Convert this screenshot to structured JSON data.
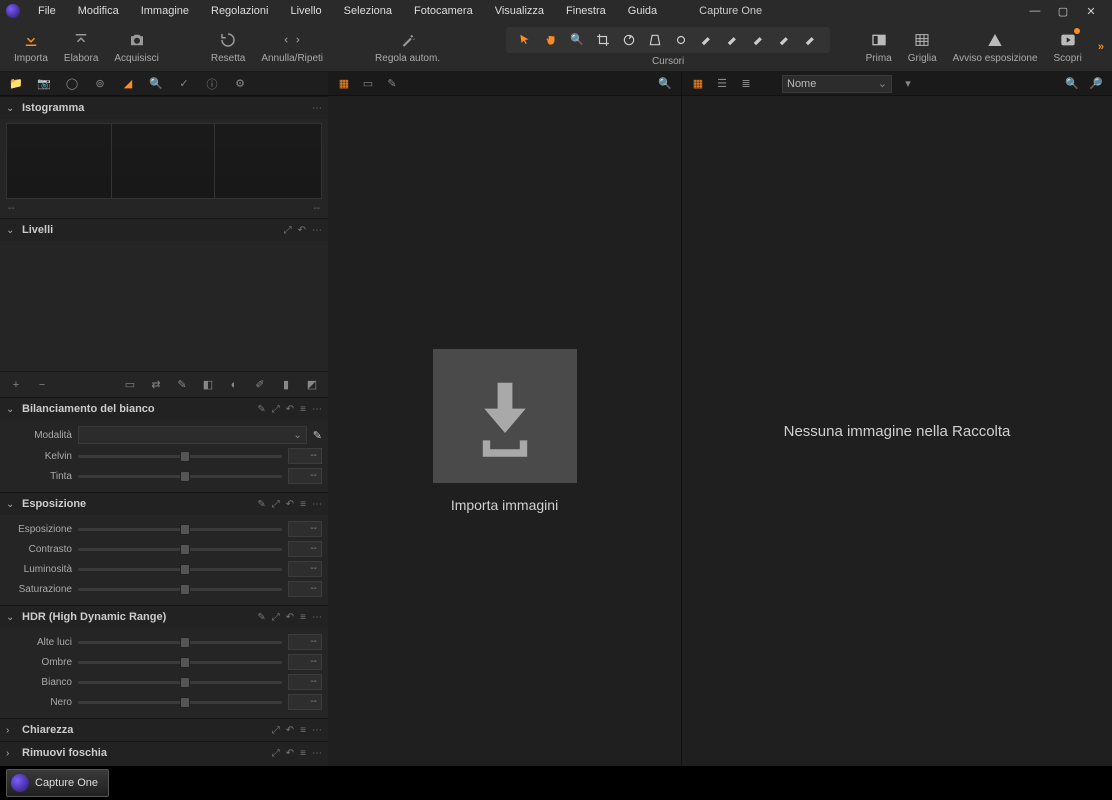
{
  "app": {
    "title": "Capture One"
  },
  "menu": [
    "File",
    "Modifica",
    "Immagine",
    "Regolazioni",
    "Livello",
    "Seleziona",
    "Fotocamera",
    "Visualizza",
    "Finestra",
    "Guida"
  ],
  "toolbar": {
    "importa": "Importa",
    "elabora": "Elabora",
    "acquisisci": "Acquisisci",
    "resetta": "Resetta",
    "annulla_ripeti": "Annulla/Ripeti",
    "regola_autom": "Regola autom.",
    "cursori": "Cursori",
    "prima": "Prima",
    "griglia": "Griglia",
    "avviso_esposizione": "Avviso esposizione",
    "scopri": "Scopri"
  },
  "viewer": {
    "import_label": "Importa immagini"
  },
  "browser": {
    "empty_message": "Nessuna immagine nella Raccolta",
    "sort_label": "Nome"
  },
  "panels": {
    "istogramma": {
      "title": "Istogramma",
      "footer_left": "--",
      "footer_right": "--"
    },
    "livelli": {
      "title": "Livelli"
    },
    "bilanciamento": {
      "title": "Bilanciamento del bianco",
      "modalita_label": "Modalità",
      "sliders": [
        {
          "label": "Kelvin",
          "value": "--",
          "pos": 50
        },
        {
          "label": "Tinta",
          "value": "--",
          "pos": 50
        }
      ]
    },
    "esposizione": {
      "title": "Esposizione",
      "sliders": [
        {
          "label": "Esposizione",
          "value": "--",
          "pos": 50
        },
        {
          "label": "Contrasto",
          "value": "--",
          "pos": 50
        },
        {
          "label": "Luminosità",
          "value": "--",
          "pos": 50
        },
        {
          "label": "Saturazione",
          "value": "--",
          "pos": 50
        }
      ]
    },
    "hdr": {
      "title": "HDR (High Dynamic Range)",
      "sliders": [
        {
          "label": "Alte luci",
          "value": "--",
          "pos": 50
        },
        {
          "label": "Ombre",
          "value": "--",
          "pos": 50
        },
        {
          "label": "Bianco",
          "value": "--",
          "pos": 50
        },
        {
          "label": "Nero",
          "value": "--",
          "pos": 50
        }
      ]
    },
    "chiarezza": {
      "title": "Chiarezza"
    },
    "rimuovi_foschia": {
      "title": "Rimuovi foschia"
    }
  },
  "taskbar": {
    "app_button": "Capture One"
  }
}
